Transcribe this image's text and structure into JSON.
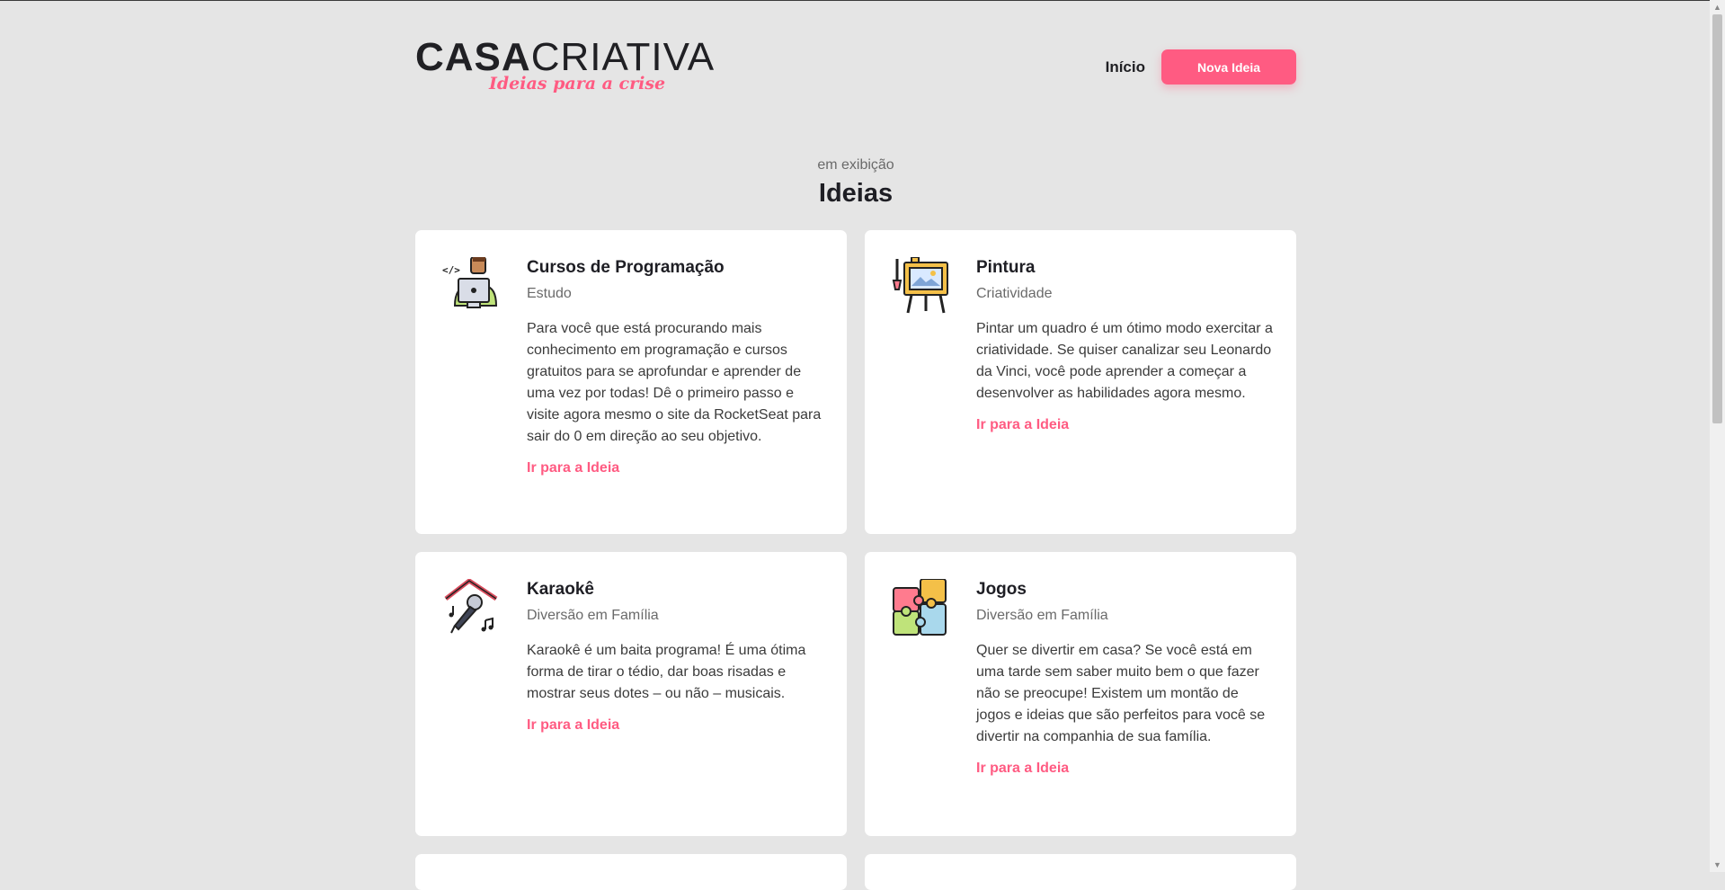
{
  "logo": {
    "bold": "CASA",
    "light": "CRIATIVA",
    "tagline": "Ideias para a crise"
  },
  "nav": {
    "home_label": "Início",
    "new_idea_label": "Nova Ideia"
  },
  "section": {
    "subtitle": "em exibição",
    "title": "Ideias"
  },
  "cards": [
    {
      "title": "Cursos de Programação",
      "category": "Estudo",
      "description": "Para você que está procurando mais conhecimento em programação e cursos gratuitos para se aprofundar e aprender de uma vez por todas! Dê o primeiro passo e visite agora mesmo o site da RocketSeat para sair do 0 em direção ao seu objetivo.",
      "link": "Ir para a Ideia",
      "icon": "programmer-icon"
    },
    {
      "title": "Pintura",
      "category": "Criatividade",
      "description": "Pintar um quadro é um ótimo modo exercitar a criatividade. Se quiser canalizar seu Leonardo da Vinci, você pode aprender a começar a desenvolver as habilidades agora mesmo.",
      "link": "Ir para a Ideia",
      "icon": "easel-icon"
    },
    {
      "title": "Karaokê",
      "category": "Diversão em Família",
      "description": "Karaokê é um baita programa! É uma ótima forma de tirar o tédio, dar boas risadas e mostrar seus dotes – ou não – musicais.",
      "link": "Ir para a Ideia",
      "icon": "microphone-icon"
    },
    {
      "title": "Jogos",
      "category": "Diversão em Família",
      "description": "Quer se divertir em casa? Se você está em uma tarde sem saber muito bem o que fazer não se preocupe! Existem um montão de jogos e ideias que são perfeitos para você se divertir na companhia de sua família.",
      "link": "Ir para a Ideia",
      "icon": "puzzle-icon"
    }
  ],
  "colors": {
    "accent": "#ff5b82",
    "background": "#e5e5e5",
    "card": "#ffffff"
  }
}
